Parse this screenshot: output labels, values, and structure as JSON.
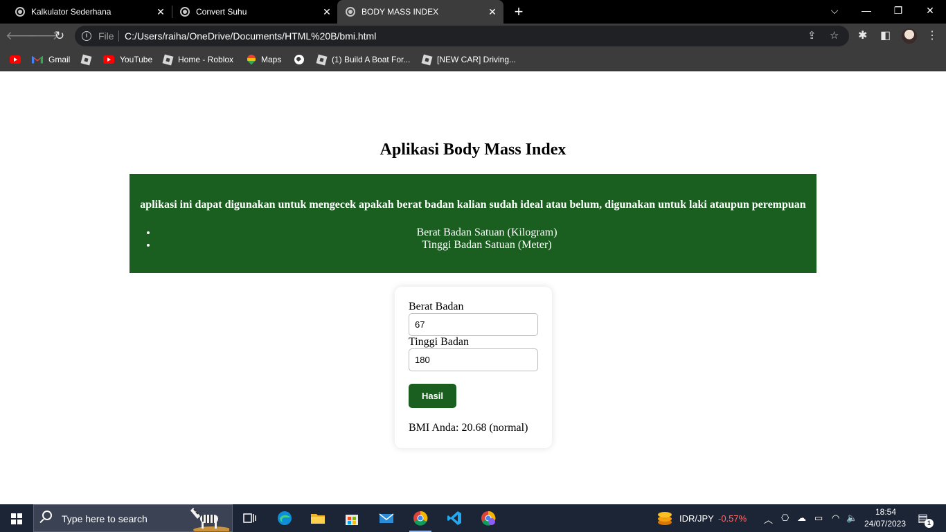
{
  "browser": {
    "tabs": [
      {
        "label": "Kalkulator Sederhana",
        "active": false
      },
      {
        "label": "Convert Suhu",
        "active": false
      },
      {
        "label": "BODY MASS INDEX",
        "active": true
      }
    ],
    "new_tab": "+",
    "window_controls": {
      "dropdown": "⌵",
      "minimize": "—",
      "restore": "❐",
      "close": "✕"
    },
    "address": {
      "scheme": "File",
      "url": "C:/Users/raiha/OneDrive/Documents/HTML%20B/bmi.html"
    },
    "bookmarks": [
      {
        "label": "",
        "icon": "youtube-icon"
      },
      {
        "label": "Gmail",
        "icon": "gmail-icon"
      },
      {
        "label": "",
        "icon": "roblox-icon"
      },
      {
        "label": "YouTube",
        "icon": "youtube-icon"
      },
      {
        "label": "Home - Roblox",
        "icon": "roblox-icon"
      },
      {
        "label": "Maps",
        "icon": "maps-icon"
      },
      {
        "label": "",
        "icon": "globe-icon"
      },
      {
        "label": "(1) Build A Boat For...",
        "icon": "roblox-icon"
      },
      {
        "label": "[NEW CAR] Driving...",
        "icon": "roblox-icon"
      }
    ]
  },
  "app": {
    "title": "Aplikasi Body Mass Index",
    "description": "aplikasi ini dapat digunakan untuk mengecek apakah berat badan kalian sudah ideal atau belum, digunakan untuk laki ataupun perempuan",
    "units": [
      "Berat Badan Satuan (Kilogram)",
      "Tinggi Badan Satuan (Meter)"
    ],
    "form": {
      "weight_label": "Berat Badan",
      "weight_value": "67",
      "height_label": "Tinggi Badan",
      "height_value": "180",
      "submit_label": "Hasil",
      "result": "BMI Anda: 20.68 (normal)"
    },
    "accent_color": "#1a5e20"
  },
  "taskbar": {
    "search_placeholder": "Type here to search",
    "ticker_symbol": "IDR/JPY",
    "ticker_change": "-0.57%",
    "ticker_color": "#ff6b6b",
    "time": "18:54",
    "date": "24/07/2023",
    "notification_count": "1"
  }
}
